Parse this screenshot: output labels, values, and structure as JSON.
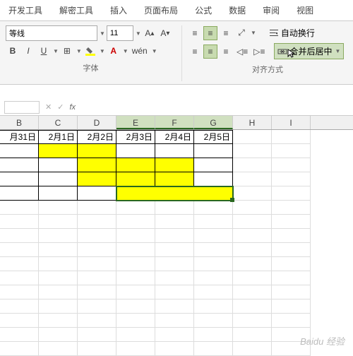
{
  "tabs": [
    "开发工具",
    "解密工具",
    "插入",
    "页面布局",
    "公式",
    "数据",
    "审阅",
    "视图"
  ],
  "font": {
    "name": "等线",
    "size": "11",
    "group_label": "字体",
    "bold": "B",
    "italic": "I",
    "underline": "U",
    "wen": "wén"
  },
  "align": {
    "group_label": "对齐方式",
    "wrap": "自动换行",
    "merge": "合并后居中"
  },
  "formula_bar": {
    "fx": "fx",
    "cancel": "✕",
    "confirm": "✓"
  },
  "columns": [
    "B",
    "C",
    "D",
    "E",
    "F",
    "G",
    "H",
    "I"
  ],
  "dates": [
    "月31日",
    "2月1日",
    "2月2日",
    "2月3日",
    "2月4日",
    "2月5日"
  ],
  "watermark": "Baidu 经验"
}
